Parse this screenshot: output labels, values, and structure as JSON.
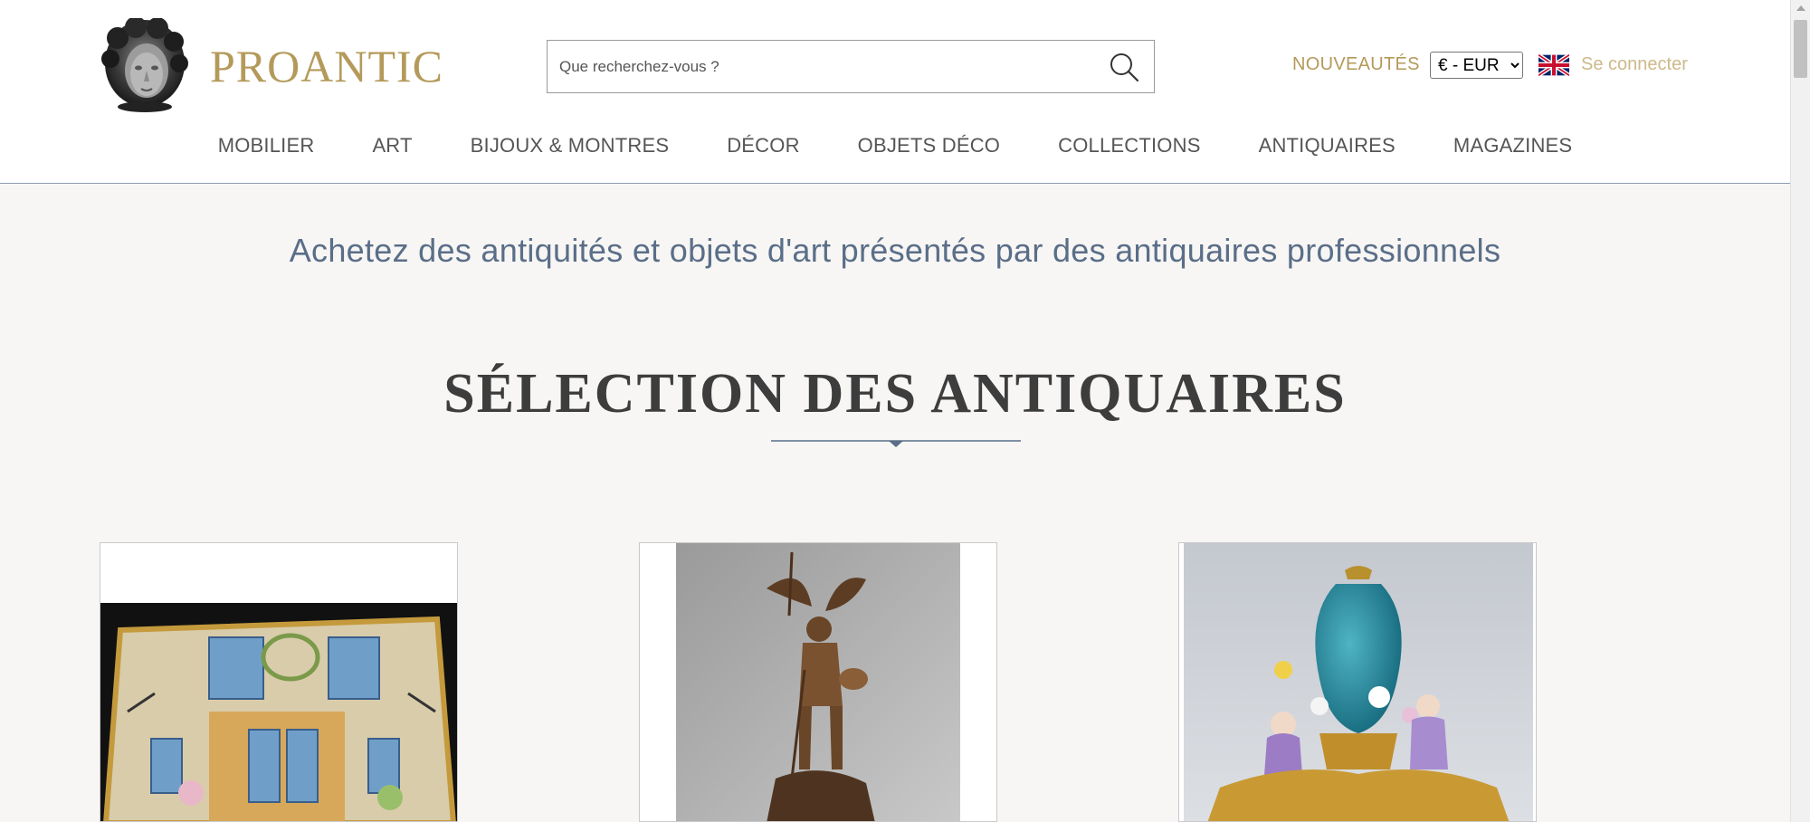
{
  "header": {
    "logo_text": "PROANTIC",
    "search": {
      "placeholder": "Que recherchez-vous ?",
      "value": ""
    },
    "nouveautes_label": "NOUVEAUTÉS",
    "currency": {
      "selected": "€ - EUR",
      "options": [
        "€ - EUR"
      ]
    },
    "language_flag": "uk-flag-icon",
    "login_label": "Se connecter"
  },
  "nav": {
    "items": [
      {
        "label": "MOBILIER"
      },
      {
        "label": "ART"
      },
      {
        "label": "BIJOUX & MONTRES"
      },
      {
        "label": "DÉCOR"
      },
      {
        "label": "OBJETS DÉCO"
      },
      {
        "label": "COLLECTIONS"
      },
      {
        "label": "ANTIQUAIRES"
      },
      {
        "label": "MAGAZINES"
      }
    ]
  },
  "main": {
    "tagline": "Achetez des antiquités et objets d'art présentés par des antiquaires professionnels",
    "section_title": "SÉLECTION DES ANTIQUAIRES"
  },
  "colors": {
    "gold": "#b49a5a",
    "gold_light": "#cdb98a",
    "slate_blue": "#5a6e88",
    "background": "#f7f6f4"
  }
}
